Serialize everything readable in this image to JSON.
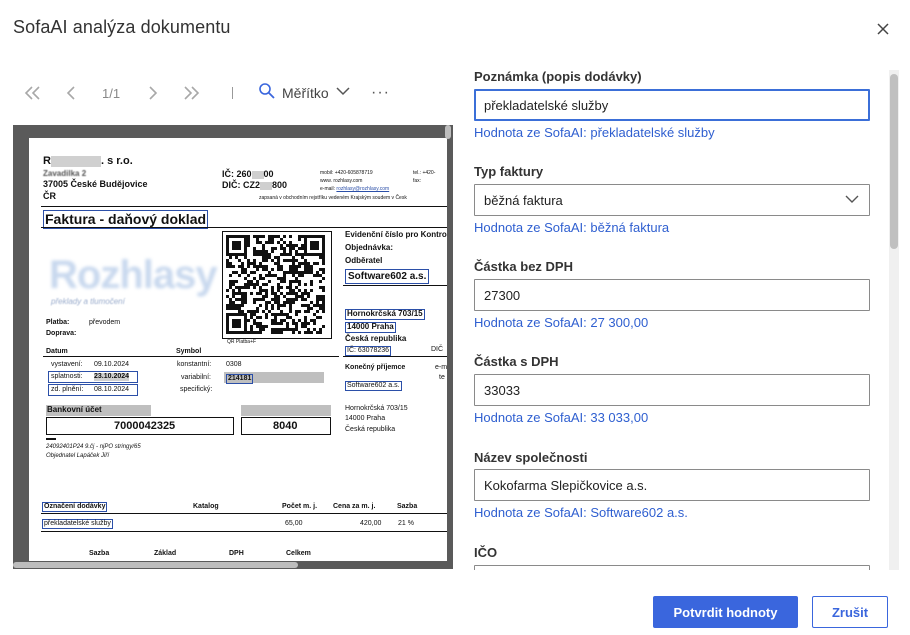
{
  "dialog": {
    "title": "SofaAI analýza dokumentu"
  },
  "toolbar": {
    "page_indicator": "1/1",
    "zoom_label": "Měřítko",
    "more": "···",
    "icons": [
      "first-page-icon",
      "prev-page-icon",
      "next-page-icon",
      "last-page-icon",
      "search-icon",
      "chevron-down-icon",
      "more-icon"
    ]
  },
  "invoice": {
    "seller_name": "R",
    "seller_suffix": ". s r.o.",
    "seller_street": "Zavadilka 2",
    "seller_city": "37005  České Budějovice",
    "seller_country": "ČR",
    "ic_label": "IČ:",
    "ic_value": "260",
    "ic_value2": "00",
    "dic_label": "DIČ:",
    "dic_value": "CZ2",
    "dic_value2": "800",
    "mobil": "mobil: +420-605878719",
    "web": "www. rozhlasy.com",
    "email_label": "e-mail:",
    "email": "rozhlasy@rozhlasy.com",
    "tel": "tel.:  +420-",
    "fax": "fax:",
    "register": "zapsaná v obchodním rejstříku vedeném Krajským soudem v Česk",
    "doc_title": "Faktura -  daňový doklad",
    "evidencni": "Evidenční číslo pro Kontrolní",
    "objednavka": "Objednávka:",
    "odberatel": "Odběratel",
    "buyer_name": "Software602 a.s.",
    "logo_tagline": "překlady a tlumočení",
    "buyer_street": "Hornokrčská 703/15",
    "buyer_city": "14000  Praha",
    "buyer_country": "Česká republika",
    "buyer_ic": "IČ: 63078236",
    "dic_short": "DIČ",
    "qr_label": "QR Platba+F",
    "platba_label": "Platba:",
    "platba_value": "převodem",
    "doprava_label": "Doprava:",
    "datum_label": "Datum",
    "symbol_label": "Symbol",
    "vystaveni_label": "vystavení:",
    "vystaveni_value": "09.10.2024",
    "splatnosti_label": "splatnosti:",
    "splatnosti_value": "23.10.2024",
    "plneni_label": "zd. plnění:",
    "plneni_value": "08.10.2024",
    "konstantni_label": "konstantní:",
    "konstantni_value": "0308",
    "variabilni_label": "variabilní:",
    "variabilni_value": "214181",
    "specificky_label": "specifický:",
    "konecny_label": "Konečný příjemce",
    "konecny_name": "Software602 a.s.",
    "konecny_street": "Hornokrčská 703/15",
    "konecny_city": "14000  Praha",
    "konecny_country": "Česká republika",
    "email_short": "e-ma",
    "tel_short": "te",
    "bank_label": "Bankovní účet",
    "account": "7000042325",
    "bank_code": "8040",
    "note1": "24092401P24 9.čj - njPO stringy/65",
    "note2": "Objednatel Lapáček Jiří",
    "col_item": "Označení dodávky",
    "col_catalog": "Katalog",
    "col_qty": "Počet  m. j.",
    "col_price": "Cena za m. j.",
    "col_rate": "Sazba",
    "row_item": "překladatelské služby",
    "row_qty": "65,00",
    "row_price": "420,00",
    "row_rate": "21  %",
    "sum_sazba": "Sazba",
    "sum_zaklad": "Základ",
    "sum_dph": "DPH",
    "sum_celkem": "Celkem"
  },
  "form": {
    "fields": [
      {
        "label": "Poznámka (popis dodávky)",
        "value": "překladatelské služby",
        "hint": "Hodnota ze SofaAI: překladatelské služby"
      },
      {
        "label": "Typ faktury",
        "value": "běžná faktura",
        "hint": "Hodnota ze SofaAI: běžná faktura"
      },
      {
        "label": "Částka bez DPH",
        "value": "27300",
        "hint": "Hodnota ze SofaAI: 27 300,00"
      },
      {
        "label": "Částka s DPH",
        "value": "33033",
        "hint": "Hodnota ze SofaAI: 33 033,00"
      },
      {
        "label": "Název společnosti",
        "value": "Kokofarma Slepičkovice a.s.",
        "hint": "Hodnota ze SofaAI: Software602 a.s."
      },
      {
        "label": "IČO",
        "value": "",
        "hint": ""
      }
    ]
  },
  "buttons": {
    "confirm": "Potvrdit hodnoty",
    "cancel": "Zrušit"
  },
  "colors": {
    "accent": "#3a66dd",
    "hint": "#2f5fd0"
  }
}
